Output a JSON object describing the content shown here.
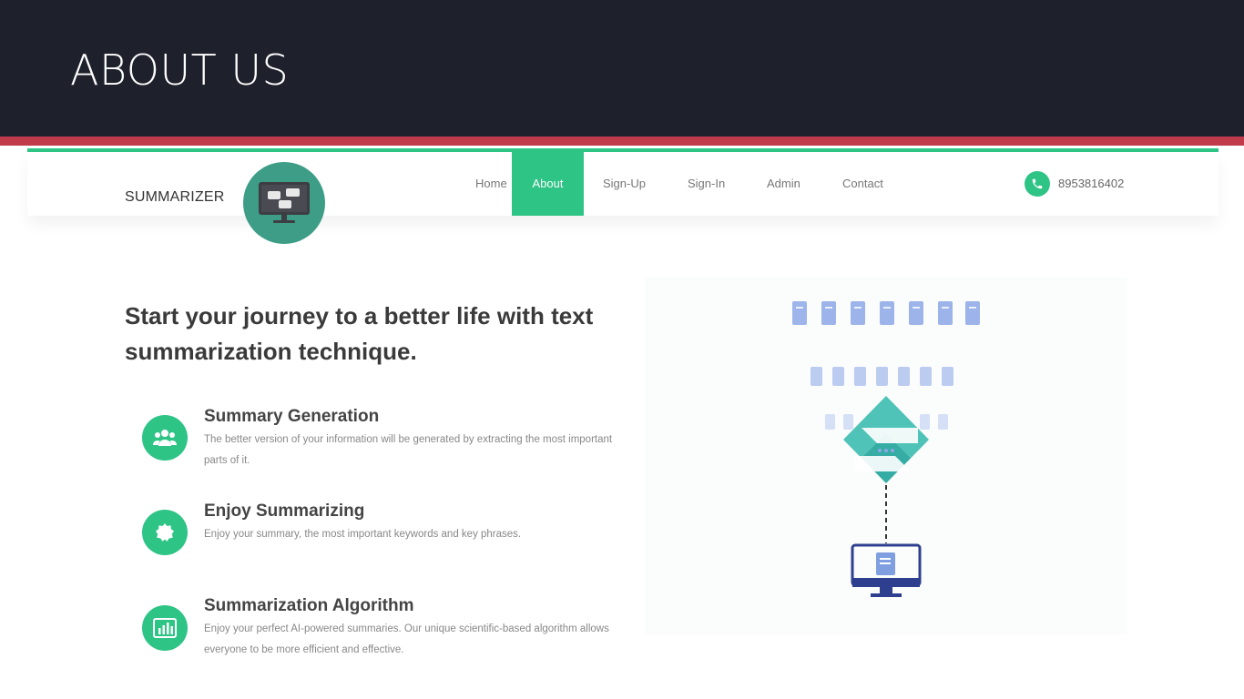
{
  "slide": {
    "title": "ABOUT US"
  },
  "site": {
    "brand": "SUMMARIZER",
    "nav": [
      "Home",
      "About",
      "Sign-Up",
      "Sign-In",
      "Admin",
      "Contact"
    ],
    "active_nav": "About",
    "phone": "8953816402"
  },
  "hero": {
    "headline": "Start your journey to a better life with text summarization technique."
  },
  "features": [
    {
      "title": "Summary Generation",
      "description": "The better version of your information will be generated by extracting the most important parts of it.",
      "icon": "users-icon"
    },
    {
      "title": "Enjoy Summarizing",
      "description": "Enjoy your summary, the most important keywords and key phrases.",
      "icon": "badge-icon"
    },
    {
      "title": "Summarization Algorithm",
      "description": "Enjoy your perfect AI-powered summaries. Our unique scientific-based algorithm allows everyone to be more efficient and effective.",
      "icon": "bar-chart-icon"
    }
  ],
  "colors": {
    "header_bg": "#1e202c",
    "accent_red": "#c03a4b",
    "brand_green": "#2ec486",
    "logo_teal": "#3e9d86",
    "navy": "#2f3f8f",
    "doc_blue": "#7f9fe0"
  }
}
